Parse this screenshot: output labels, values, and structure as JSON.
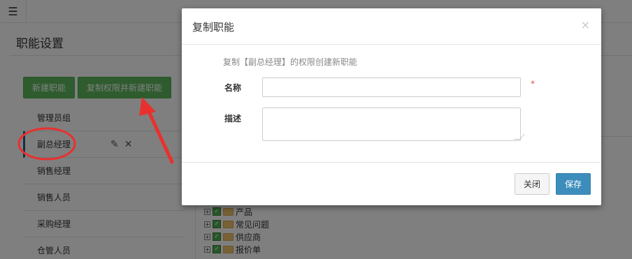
{
  "topbar": {
    "menu_icon": "☰"
  },
  "page": {
    "title": "职能设置"
  },
  "left_panel": {
    "new_role_label": "新建职能",
    "copy_role_label": "复制权限并新建职能",
    "roles": [
      {
        "label": "管理员组"
      },
      {
        "label": "副总经理"
      },
      {
        "label": "销售经理"
      },
      {
        "label": "销售人员"
      },
      {
        "label": "采购经理"
      },
      {
        "label": "仓管人员"
      }
    ],
    "active_role_index": 1,
    "edit_icon": "✎",
    "delete_icon": "✕"
  },
  "tree": {
    "items": [
      {
        "label": "产品"
      },
      {
        "label": "常见问题"
      },
      {
        "label": "供应商"
      },
      {
        "label": "报价单"
      }
    ]
  },
  "modal": {
    "title": "复制职能",
    "close_icon": "×",
    "description": "复制【副总经理】的权限创建新职能",
    "name_label": "名称",
    "name_value": "",
    "required_mark": "*",
    "desc_label": "描述",
    "desc_value": "",
    "close_button": "关闭",
    "save_button": "保存"
  },
  "annotation_colors": {
    "highlight": "#e8312f"
  }
}
